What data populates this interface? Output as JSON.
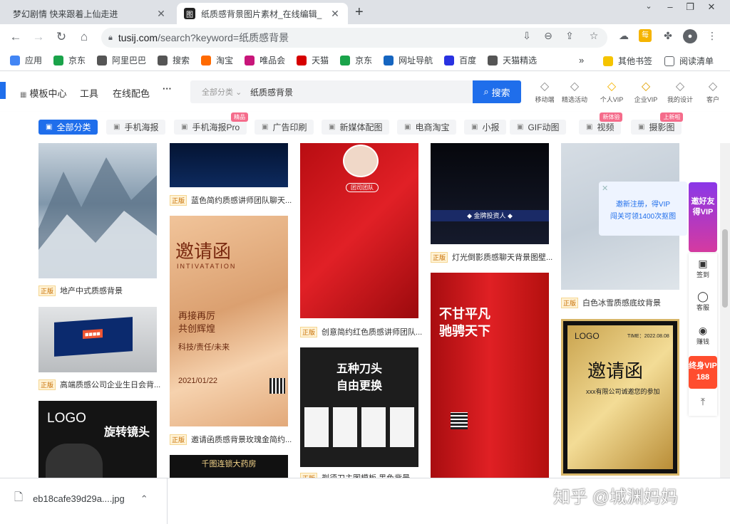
{
  "tabs": [
    {
      "title": "梦幻剧情 快来跟着上仙走进"
    },
    {
      "title": "纸质感背景图片素材_在线编辑_"
    }
  ],
  "omnibox": {
    "domain": "tusij.com",
    "path": "/search?keyword=纸质感背景"
  },
  "bookmarks": [
    {
      "label": "应用",
      "icon": "apps-icon",
      "color": "#4285f4"
    },
    {
      "label": "京东",
      "icon": "jd-icon",
      "color": "#1aa34a"
    },
    {
      "label": "阿里巴巴",
      "icon": "globe-icon",
      "color": "#555555"
    },
    {
      "label": "搜索",
      "icon": "globe-icon",
      "color": "#555555"
    },
    {
      "label": "淘宝",
      "icon": "taobao-icon",
      "color": "#ff6a00"
    },
    {
      "label": "唯品会",
      "icon": "vip-icon",
      "color": "#c8167a"
    },
    {
      "label": "天猫",
      "icon": "tmall-icon",
      "color": "#d60000"
    },
    {
      "label": "京东",
      "icon": "jd-icon",
      "color": "#1aa34a"
    },
    {
      "label": "网址导航",
      "icon": "nav-icon",
      "color": "#1565c0"
    },
    {
      "label": "百度",
      "icon": "baidu-icon",
      "color": "#2932e1"
    },
    {
      "label": "天猫精选",
      "icon": "globe-icon",
      "color": "#555555"
    }
  ],
  "bookmarks_more": "»",
  "bookmarks_right": [
    {
      "label": "其他书签"
    },
    {
      "label": "阅读清单"
    }
  ],
  "site": {
    "nav": [
      "模板中心",
      "工具",
      "在线配色",
      "···"
    ],
    "search_category": "全部分类",
    "search_query": "纸质感背景",
    "search_button": "搜索",
    "header_icons": [
      {
        "label": "移动端",
        "icon": "mobile-icon",
        "color": "#888888"
      },
      {
        "label": "精选活动",
        "icon": "gift-icon",
        "color": "#888888"
      },
      {
        "label": "个人VIP",
        "icon": "diamond-icon",
        "color": "#f5b400"
      },
      {
        "label": "企业VIP",
        "icon": "crown-icon",
        "color": "#e0a000"
      },
      {
        "label": "我的设计",
        "icon": "tools-icon",
        "color": "#888888"
      },
      {
        "label": "客户",
        "icon": "monitor-icon",
        "color": "#888888"
      }
    ]
  },
  "categories": [
    {
      "label": "全部分类",
      "active": true,
      "badge": ""
    },
    {
      "label": "手机海报",
      "active": false,
      "badge": ""
    },
    {
      "label": "手机海报Pro",
      "active": false,
      "badge": "精品"
    },
    {
      "label": "广告印刷",
      "active": false,
      "badge": ""
    },
    {
      "label": "新媒体配图",
      "active": false,
      "badge": ""
    },
    {
      "label": "电商淘宝",
      "active": false,
      "badge": ""
    },
    {
      "label": "小报",
      "active": false,
      "badge": ""
    },
    {
      "label": "GIF动图",
      "active": false,
      "badge": ""
    },
    {
      "label": "视频",
      "active": false,
      "badge": "新体验"
    },
    {
      "label": "摄影图",
      "active": false,
      "badge": "上新啦"
    }
  ],
  "cards": [
    {
      "caption": "地产中式质感背景",
      "tag": "正版"
    },
    {
      "caption": "高端质感公司企业生日会背...",
      "tag": "正版"
    },
    {
      "caption": "蓝色简约质感讲师团队聊天...",
      "tag": "正版"
    },
    {
      "caption": "邀请函质感背景玫瑰金简约...",
      "tag": "正版"
    },
    {
      "caption": "创意简约红色质感讲师团队...",
      "tag": "正版"
    },
    {
      "caption": "剃须刀主图模板 黑色背景",
      "tag": "正版"
    },
    {
      "caption": "灯光倒影质感聊天背景图壁...",
      "tag": "正版"
    },
    {
      "caption": "白色冰雪质感底纹背景",
      "tag": "正版"
    }
  ],
  "poster_text": {
    "invite_title": "邀请函",
    "invite_sub": "INTIVATATION",
    "invite_line1": "再接再厉",
    "invite_line2": "共创辉煌",
    "invite_line3": "科技/责任/未来",
    "invite_date": "2021/01/22",
    "red_team": "团司团队",
    "gold_logo": "LOGO",
    "gold_title": "邀请函",
    "gold_time": "TIME：2022.08.08",
    "gold_sub": "xxx有限公司诚邀您的参加",
    "razor_line1": "五种刀头",
    "razor_line2": "自由更换",
    "slogan_line1": "不甘平凡",
    "slogan_line2": "驰骋天下",
    "camera_logo": "LOGO",
    "camera_title": "旋转镜头",
    "pharmacy": "千图连锁大药房",
    "investor": "◆ 金牌投资人 ◆"
  },
  "float_promo": {
    "line1": "邀新注册，得VIP",
    "line2": "闯关可领1400次抠图"
  },
  "sidebar": [
    {
      "label": "邀好友得VIP"
    },
    {
      "label": "签到"
    },
    {
      "label": "客服"
    },
    {
      "label": "赚钱"
    },
    {
      "label": "终身VIP 188"
    }
  ],
  "download": {
    "filename": "eb18cafe39d29a....jpg"
  },
  "watermark": "知乎 @城渊妈妈"
}
